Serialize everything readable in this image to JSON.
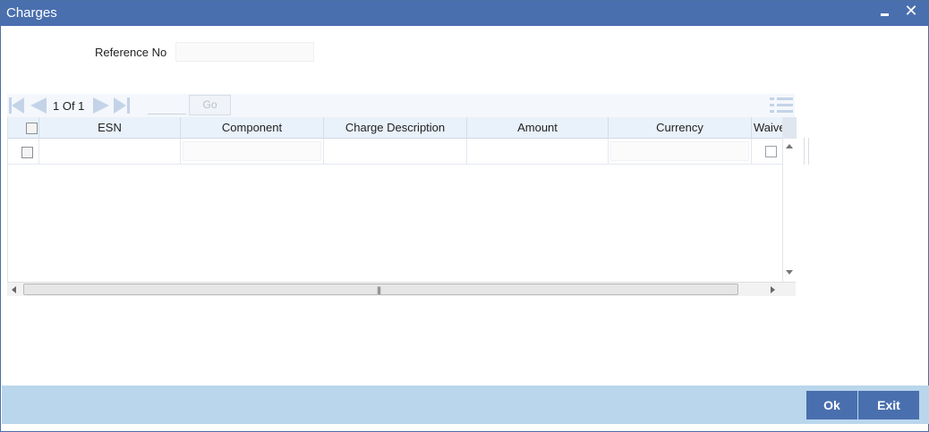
{
  "window": {
    "title": "Charges"
  },
  "form": {
    "reference_label": "Reference No",
    "reference_value": ""
  },
  "pager": {
    "page_text": "1 Of 1",
    "go_label": "Go",
    "page_input": ""
  },
  "grid": {
    "columns": [
      "ESN",
      "Component",
      "Charge Description",
      "Amount",
      "Currency",
      "Waive"
    ],
    "rows": [
      {
        "esn": "",
        "component": "",
        "charge_description": "",
        "amount": "",
        "currency": "",
        "waive": false
      }
    ]
  },
  "footer": {
    "ok_label": "Ok",
    "exit_label": "Exit"
  },
  "icons": {
    "minimize": "minimize-icon",
    "close": "close-icon",
    "first": "first-page-icon",
    "prev": "previous-page-icon",
    "next": "next-page-icon",
    "last": "last-page-icon",
    "view": "list-view-icon"
  },
  "colors": {
    "titlebar": "#4a6fae",
    "footer": "#b9d6ec",
    "button": "#4a6fae"
  }
}
